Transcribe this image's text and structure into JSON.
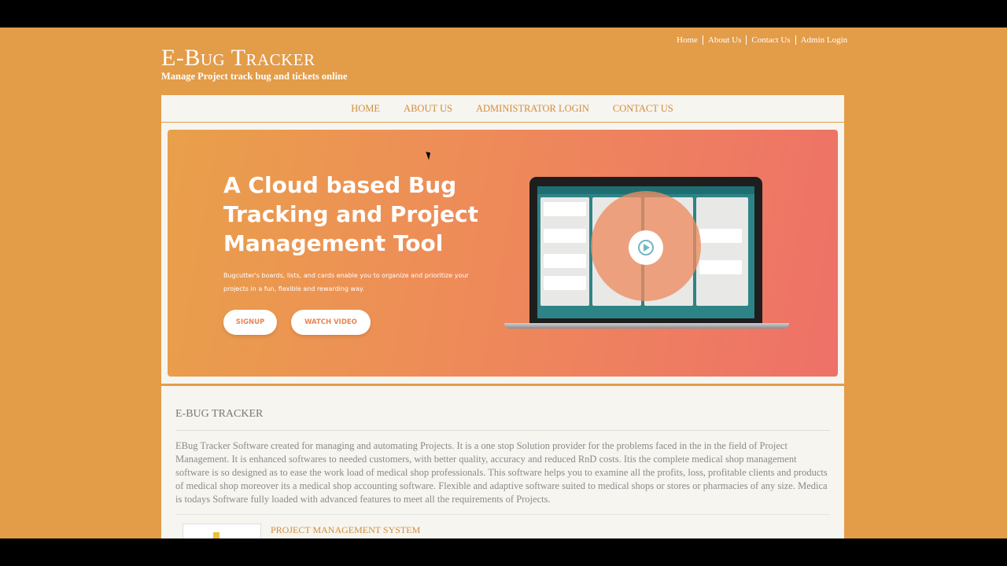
{
  "toplinks": [
    "Home",
    "About Us",
    "Contact Us",
    "Admin Login"
  ],
  "logo": {
    "title": "E-Bug Tracker",
    "tagline": "Manage Project track bug and tickets online"
  },
  "nav": [
    "HOME",
    "ABOUT US",
    "ADMINISTRATOR LOGIN",
    "CONTACT US"
  ],
  "hero": {
    "heading": "A Cloud based Bug Tracking and Project Management Tool",
    "subtext": "Bugcutter's boards, lists, and cards enable you to organize and prioritize your projects in a fun, flexible and rewarding way.",
    "signup_label": "SIGNUP",
    "watch_label": "WATCH VIDEO"
  },
  "content": {
    "heading": "E-BUG TRACKER",
    "body": "EBug Tracker Software created for managing and automating Projects. It is a one stop Solution provider for the problems faced in the in the field of Project Management. It is enhanced softwares to needed customers, with better quality, accuracy and reduced RnD costs. Itis the complete medical shop management software is so designed as to ease the work load of medical shop professionals. This software helps you to examine all the profits, loss, profitable clients and products of medical shop moreover its a medical shop accounting software. Flexible and adaptive software suited to medical shops or stores or pharmacies of any size. Medica is todays Software fully loaded with advanced features to meet all the requirements of Projects.",
    "subheading": "PROJECT MANAGEMENT SYSTEM"
  },
  "colors": {
    "background": "#E39C48",
    "accent": "#D38D3C",
    "panel": "#F6F5F0"
  },
  "icons": {
    "play": "play-circle-icon"
  }
}
